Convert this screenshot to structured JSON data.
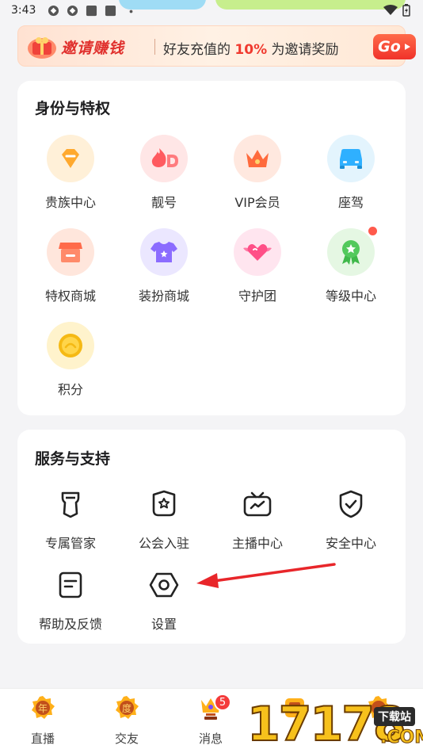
{
  "status_bar": {
    "time": "3:43"
  },
  "invite_banner": {
    "title": "邀请赚钱",
    "desc_prefix": "好友充值的",
    "desc_percent": "10%",
    "desc_suffix": "为邀请奖励",
    "go_label": "Go"
  },
  "privilege_section": {
    "title": "身份与特权",
    "items": [
      {
        "label": "贵族中心",
        "icon": "noble-diamond-icon"
      },
      {
        "label": "靓号",
        "icon": "pretty-number-icon"
      },
      {
        "label": "VIP会员",
        "icon": "vip-crown-icon"
      },
      {
        "label": "座驾",
        "icon": "car-icon"
      },
      {
        "label": "特权商城",
        "icon": "shop-icon"
      },
      {
        "label": "装扮商城",
        "icon": "clothes-icon"
      },
      {
        "label": "守护团",
        "icon": "heart-wings-icon"
      },
      {
        "label": "等级中心",
        "icon": "level-badge-icon",
        "has_dot": true
      },
      {
        "label": "积分",
        "icon": "coin-icon"
      }
    ]
  },
  "service_section": {
    "title": "服务与支持",
    "items": [
      {
        "label": "专属管家",
        "icon": "butler-tie-icon"
      },
      {
        "label": "公会入驻",
        "icon": "guild-shield-icon"
      },
      {
        "label": "主播中心",
        "icon": "tv-icon"
      },
      {
        "label": "安全中心",
        "icon": "shield-check-icon"
      },
      {
        "label": "帮助及反馈",
        "icon": "feedback-doc-icon"
      },
      {
        "label": "设置",
        "icon": "settings-hexagon-icon"
      }
    ]
  },
  "bottom_nav": {
    "items": [
      {
        "label": "直播",
        "icon": "live-icon"
      },
      {
        "label": "交友",
        "icon": "friends-icon"
      },
      {
        "label": "消息",
        "icon": "message-icon",
        "badge": "5"
      },
      {
        "label": "",
        "icon": "discover-icon"
      },
      {
        "label": "",
        "icon": "me-icon"
      }
    ]
  },
  "watermark": {
    "text": "17178",
    "tag": "下载站",
    "com": ".COM"
  },
  "colors": {
    "accent_red": "#f03a2f",
    "card_bg": "#ffffff",
    "page_bg": "#f4f4f6"
  }
}
